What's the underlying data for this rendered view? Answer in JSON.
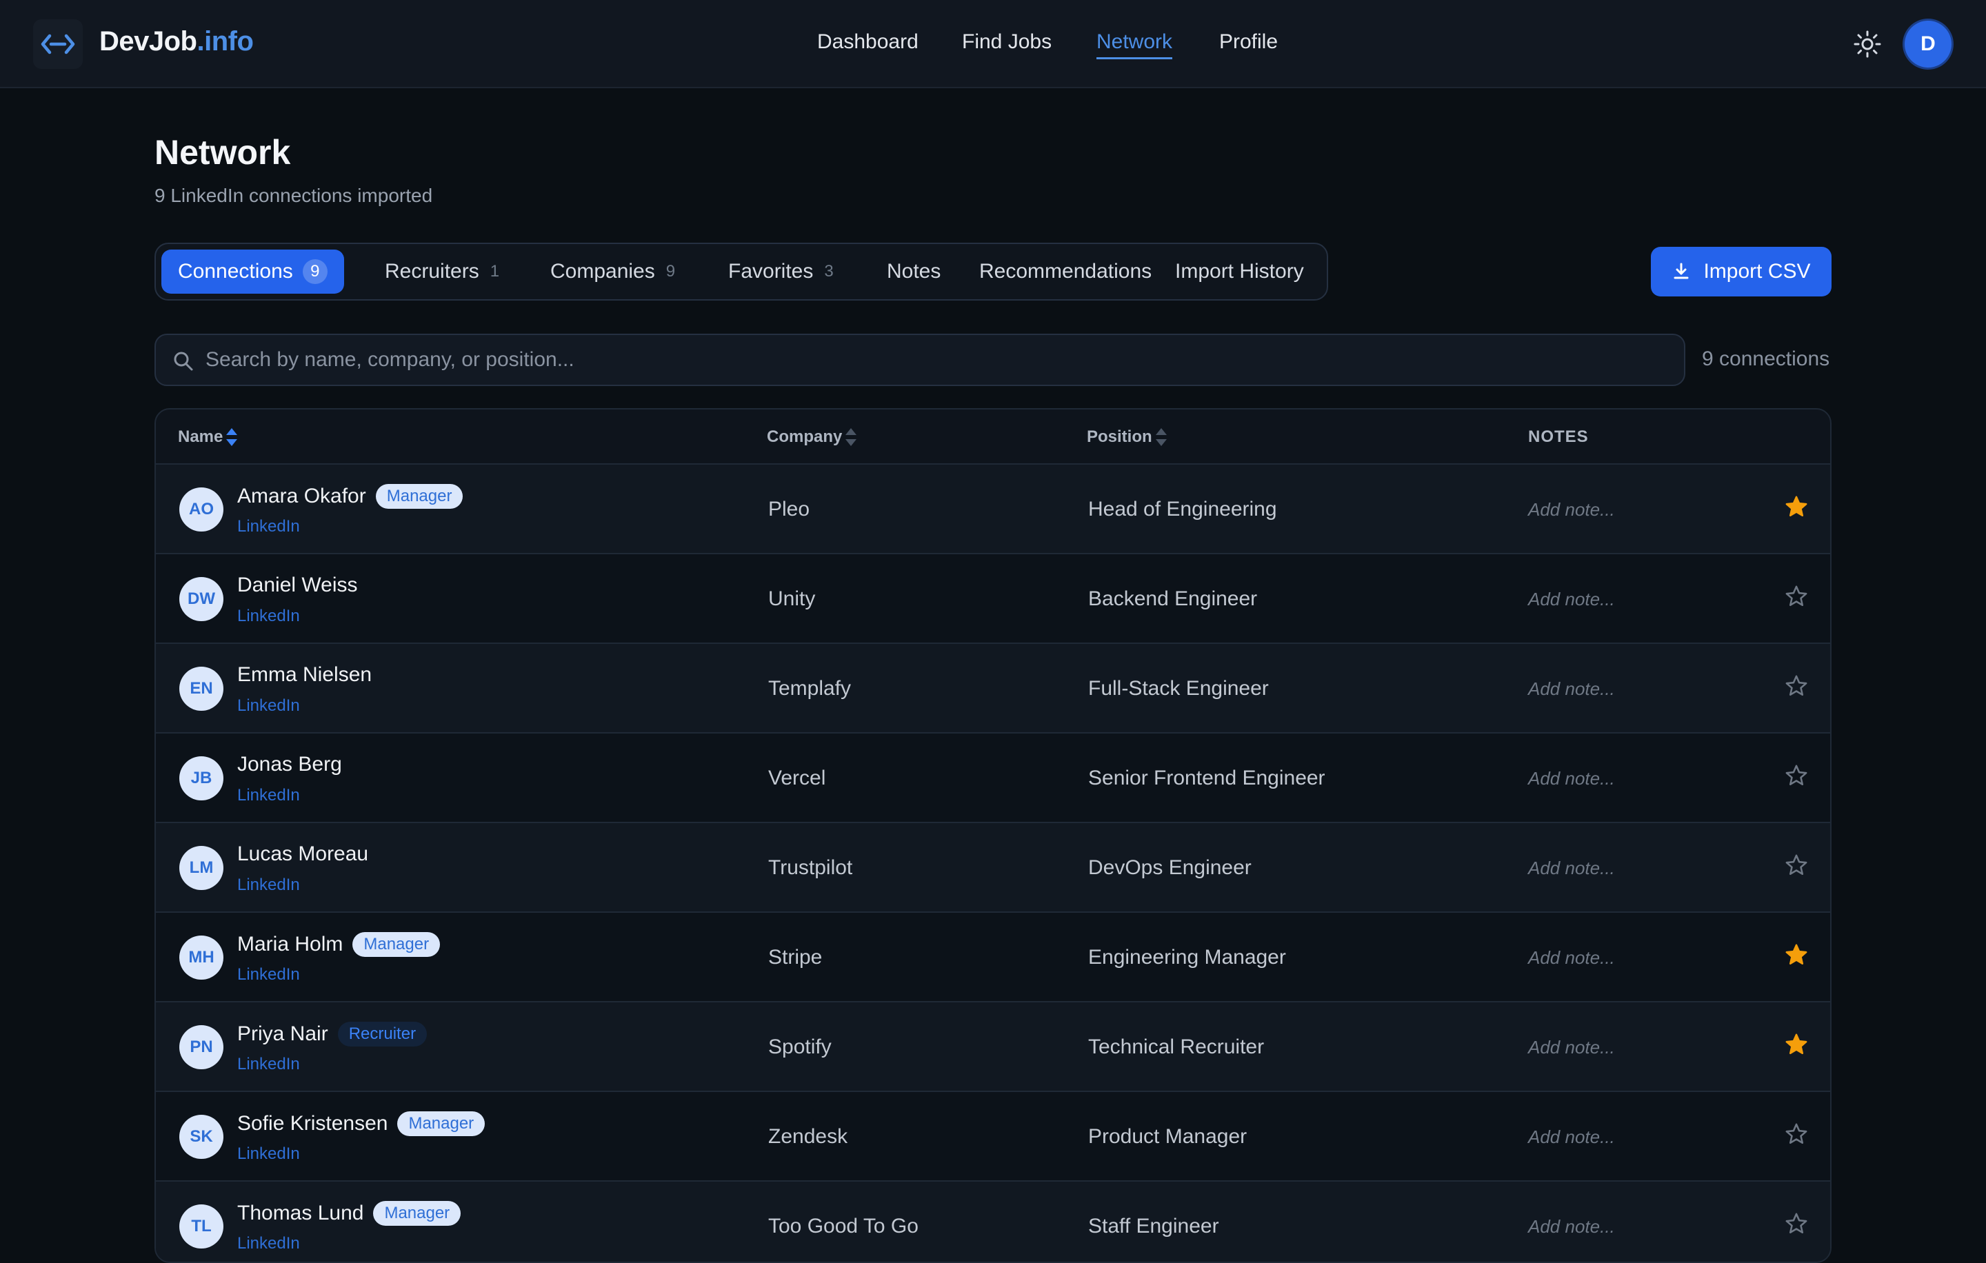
{
  "header": {
    "brand_main": "DevJob",
    "brand_accent": ".info",
    "nav": [
      "Dashboard",
      "Find Jobs",
      "Network",
      "Profile"
    ],
    "active_nav": "Network",
    "user_initial": "D",
    "theme_icon": "sun-icon"
  },
  "page": {
    "title": "Network",
    "subtitle": "9 LinkedIn connections imported"
  },
  "tabs": [
    {
      "label": "Connections",
      "count": "9",
      "active": true
    },
    {
      "label": "Recruiters",
      "count": "1"
    },
    {
      "label": "Companies",
      "count": "9"
    },
    {
      "label": "Favorites",
      "count": "3"
    },
    {
      "label": "Notes",
      "count": ""
    },
    {
      "label": "Recommendations",
      "count": ""
    },
    {
      "label": "Import History",
      "count": ""
    }
  ],
  "import_button": "Import CSV",
  "search": {
    "placeholder": "Search by name, company, or position...",
    "count_label": "9 connections"
  },
  "table": {
    "columns": [
      "Name",
      "Company",
      "Position",
      "NOTES"
    ],
    "note_placeholder": "Add note...",
    "link_label": "LinkedIn",
    "rows": [
      {
        "initials": "AO",
        "name": "Amara Okafor",
        "badge": "Manager",
        "company": "Pleo",
        "position": "Head of Engineering",
        "favorite": true
      },
      {
        "initials": "DW",
        "name": "Daniel Weiss",
        "badge": "",
        "company": "Unity",
        "position": "Backend Engineer",
        "favorite": false
      },
      {
        "initials": "EN",
        "name": "Emma Nielsen",
        "badge": "",
        "company": "Templafy",
        "position": "Full-Stack Engineer",
        "favorite": false
      },
      {
        "initials": "JB",
        "name": "Jonas Berg",
        "badge": "",
        "company": "Vercel",
        "position": "Senior Frontend Engineer",
        "favorite": false
      },
      {
        "initials": "LM",
        "name": "Lucas Moreau",
        "badge": "",
        "company": "Trustpilot",
        "position": "DevOps Engineer",
        "favorite": false
      },
      {
        "initials": "MH",
        "name": "Maria Holm",
        "badge": "Manager",
        "company": "Stripe",
        "position": "Engineering Manager",
        "favorite": true
      },
      {
        "initials": "PN",
        "name": "Priya Nair",
        "badge": "Recruiter",
        "company": "Spotify",
        "position": "Technical Recruiter",
        "favorite": true
      },
      {
        "initials": "SK",
        "name": "Sofie Kristensen",
        "badge": "Manager",
        "company": "Zendesk",
        "position": "Product Manager",
        "favorite": false
      },
      {
        "initials": "TL",
        "name": "Thomas Lund",
        "badge": "Manager",
        "company": "Too Good To Go",
        "position": "Staff Engineer",
        "favorite": false
      }
    ]
  },
  "colors": {
    "accent": "#2563eb",
    "star_active": "#f59e0b",
    "star_inactive": "#6f7885"
  }
}
